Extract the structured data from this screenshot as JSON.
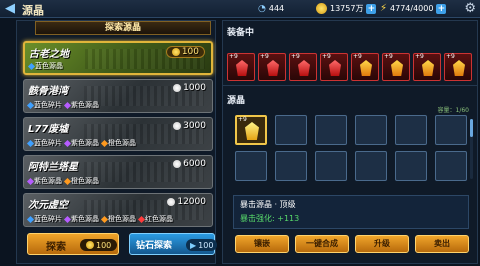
{
  "header": {
    "title": "源晶",
    "resources": {
      "wifi_value": "444",
      "gold": "13757万",
      "energy": "4774/4000"
    }
  },
  "explore": {
    "header": "探索源晶",
    "zones": [
      {
        "name": "古老之地",
        "cost": "100",
        "drops": [
          "蓝色源晶"
        ]
      },
      {
        "name": "骸骨港湾",
        "cost": "1000",
        "drops": [
          "蓝色碎片",
          "紫色源晶"
        ]
      },
      {
        "name": "L77废墟",
        "cost": "3000",
        "drops": [
          "蓝色碎片",
          "紫色源晶",
          "橙色源晶"
        ]
      },
      {
        "name": "阿特兰塔星",
        "cost": "6000",
        "drops": [
          "紫色源晶",
          "橙色源晶"
        ]
      },
      {
        "name": "次元虚空",
        "cost": "12000",
        "drops": [
          "蓝色碎片",
          "紫色源晶",
          "橙色源晶",
          "红色源晶"
        ]
      }
    ],
    "explore_button": {
      "label": "探索",
      "price": "100"
    },
    "diamond_button": {
      "label": "钻石探索",
      "price": "100"
    }
  },
  "equipped": {
    "title": "装备中",
    "slot_level": "+9"
  },
  "inventory": {
    "title": "源晶",
    "capacity": "容量：1/60",
    "selected_level": "+9"
  },
  "detail": {
    "name": "暴击源晶 · 顶级",
    "stat_label": "暴击强化:",
    "stat_value": "+113"
  },
  "actions": [
    "镶嵌",
    "一键合成",
    "升级",
    "卖出"
  ],
  "colors": {
    "gold_accent": "#e0b53a",
    "blue_gem": "#3fa0ff",
    "purple_gem": "#b65cff",
    "orange_gem": "#ff9a1f",
    "red_gem": "#ff3b3b"
  }
}
